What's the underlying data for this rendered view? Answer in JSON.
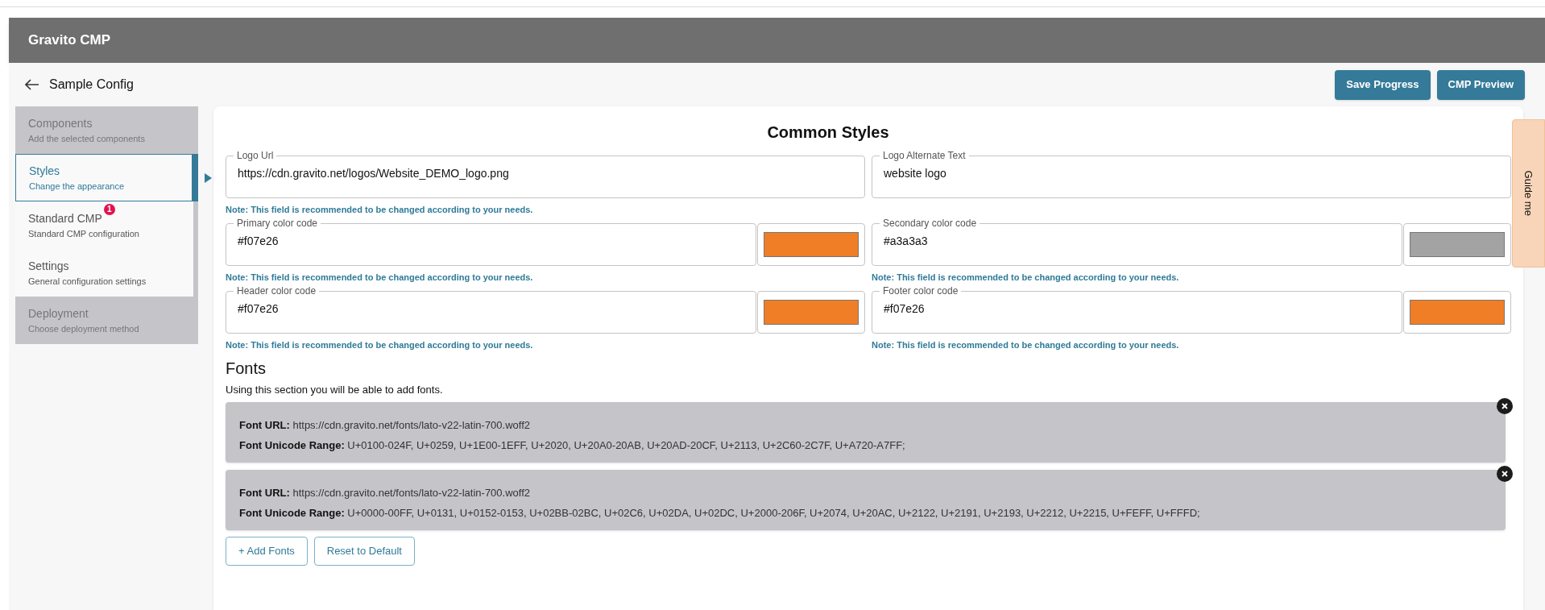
{
  "app_bar": {
    "title": "Gravito CMP"
  },
  "page": {
    "title": "Sample Config"
  },
  "actions": [
    "Save Progress",
    "CMP Preview"
  ],
  "sidebar": {
    "items": [
      {
        "title": "Components",
        "subtitle": "Add the selected components",
        "selected": false,
        "disabled": true
      },
      {
        "title": "Styles",
        "subtitle": "Change the appearance",
        "selected": true,
        "disabled": false
      },
      {
        "title": "Standard CMP",
        "subtitle": "Standard CMP configuration",
        "selected": false,
        "disabled": false,
        "badge": "1"
      },
      {
        "title": "Settings",
        "subtitle": "General configuration settings",
        "selected": false,
        "disabled": false
      },
      {
        "title": "Deployment",
        "subtitle": "Choose deployment method",
        "selected": false,
        "disabled": true
      }
    ]
  },
  "common_styles": {
    "title": "Common Styles",
    "fields": [
      {
        "label": "Logo Url",
        "value": "https://cdn.gravito.net/logos/Website_DEMO_logo.png",
        "note": "Note: This field is recommended to be changed according to your needs."
      },
      {
        "label": "Logo Alternate Text",
        "value": "website logo"
      },
      {
        "label": "Primary color code",
        "value": "#f07e26",
        "color": "#f07e26",
        "note": "Note: This field is recommended to be changed according to your needs."
      },
      {
        "label": "Secondary color code",
        "value": "#a3a3a3",
        "color": "#a3a3a3",
        "note": "Note: This field is recommended to be changed according to your needs."
      },
      {
        "label": "Header color code",
        "value": "#f07e26",
        "color": "#f07e26",
        "note": "Note: This field is recommended to be changed according to your needs."
      },
      {
        "label": "Footer color code",
        "value": "#f07e26",
        "color": "#f07e26",
        "note": "Note: This field is recommended to be changed according to your needs."
      }
    ]
  },
  "fonts": {
    "title": "Fonts",
    "description": "Using this section you will be able to add fonts.",
    "items": [
      {
        "url": "**Font URL:** https://cdn.gravito.net/fonts/lato-v22-latin-700.woff2",
        "range": "**Font Unicode Range:** U+0100-024F, U+0259, U+1E00-1EFF, U+2020, U+20A0-20AB, U+20AD-20CF, U+2113, U+2C60-2C7F, U+A720-A7FF;"
      },
      {
        "url": "**Font URL:** https://cdn.gravito.net/fonts/lato-v22-latin-700.woff2",
        "range": "**Font Unicode Range:** U+0000-00FF, U+0131, U+0152-0153, U+02BB-02BC, U+02C6, U+02DA, U+02DC, U+2000-206F, U+2074, U+20AC, U+2122, U+2191, U+2193, U+2212, U+2215, U+FEFF, U+FFFD;"
      }
    ],
    "buttons": [
      "+ Add Fonts",
      "Reset to Default"
    ]
  },
  "guide_tab": {
    "label": "Guide me"
  }
}
